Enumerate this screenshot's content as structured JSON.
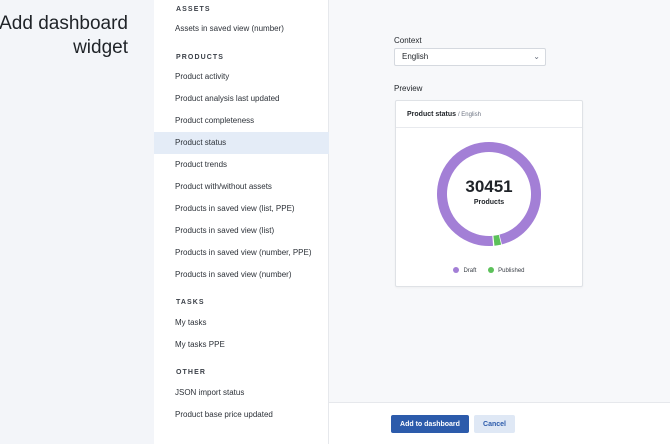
{
  "page": {
    "title": "Add dashboard widget"
  },
  "widget_list": {
    "sections": [
      {
        "heading": "ASSETS",
        "items": [
          "Assets in saved view (number)"
        ]
      },
      {
        "heading": "PRODUCTS",
        "items": [
          "Product activity",
          "Product analysis last updated",
          "Product completeness",
          "Product status",
          "Product trends",
          "Product with/without assets",
          "Products in saved view (list, PPE)",
          "Products in saved view (list)",
          "Products in saved view (number, PPE)",
          "Products in saved view (number)"
        ]
      },
      {
        "heading": "TASKS",
        "items": [
          "My tasks",
          "My tasks PPE"
        ]
      },
      {
        "heading": "OTHER",
        "items": [
          "JSON import status",
          "Product base price updated"
        ]
      }
    ],
    "selected": "Product status"
  },
  "context": {
    "label": "Context",
    "selected": "English"
  },
  "preview": {
    "label": "Preview",
    "card_title": "Product status",
    "card_subtitle": "/ English",
    "total": "30451",
    "total_caption": "Products"
  },
  "chart_data": {
    "type": "pie",
    "categories": [
      "Draft",
      "Published"
    ],
    "values": [
      97.5,
      2.5
    ],
    "colors": [
      "#a37fd6",
      "#5cc15a"
    ]
  },
  "footer": {
    "add_label": "Add to dashboard",
    "cancel_label": "Cancel"
  },
  "colors": {
    "accent": "#2c5bab",
    "selected_row": "#e4ecf7",
    "draft": "#a37fd6",
    "published": "#5cc15a"
  }
}
